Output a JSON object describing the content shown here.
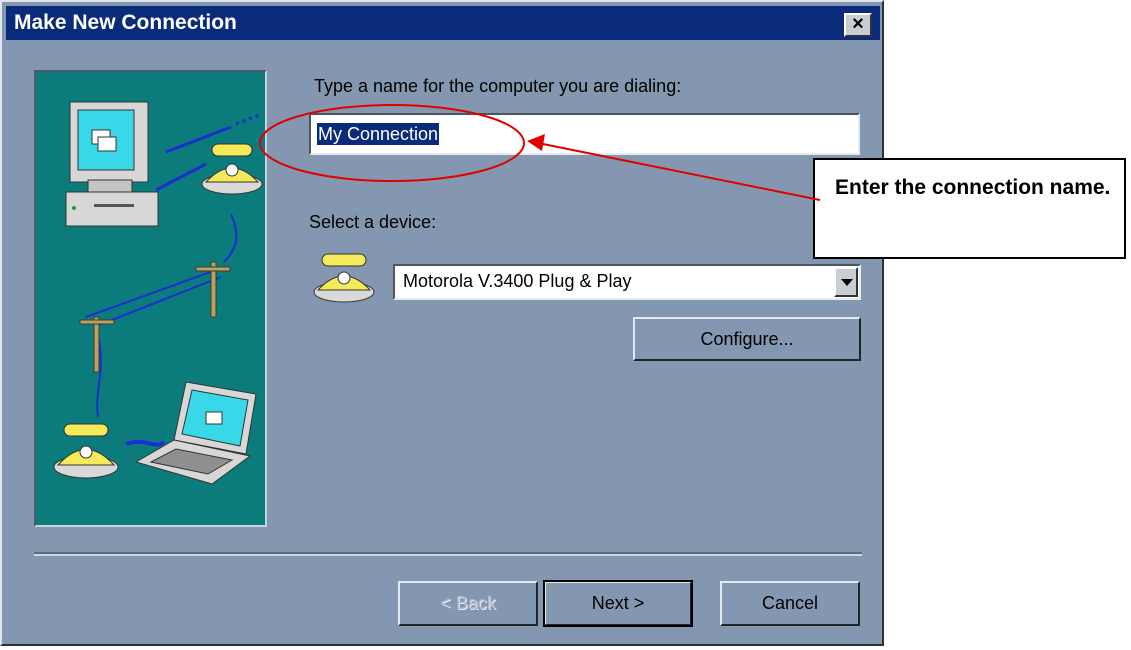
{
  "dialog": {
    "title": "Make New Connection",
    "close_glyph": "✕"
  },
  "name_section": {
    "label": "Type a name for the computer you are dialing:",
    "value": "My Connection"
  },
  "device_section": {
    "label": "Select a device:",
    "selected": "Motorola V.3400 Plug & Play",
    "configure_label": "Configure..."
  },
  "buttons": {
    "back": "< Back",
    "next": "Next >",
    "cancel": "Cancel"
  },
  "callout": {
    "text": "Enter the connection name."
  },
  "colors": {
    "dialog_bg": "#8497b0",
    "titlebar": "#0a2a7a",
    "illustration_bg": "#0b7b7b",
    "annotation": "#e00000"
  }
}
